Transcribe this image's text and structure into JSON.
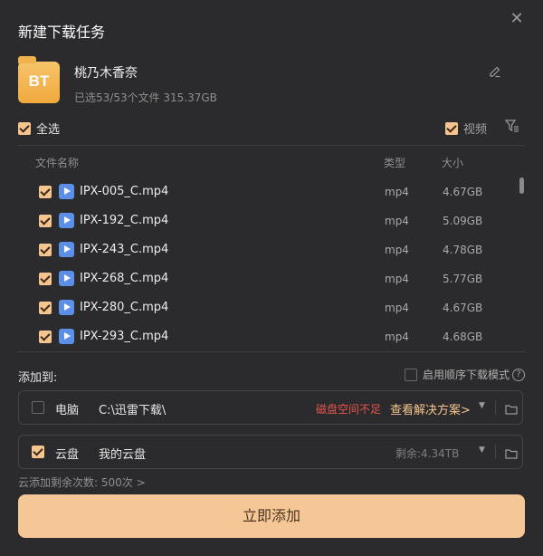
{
  "dialog": {
    "title": "新建下载任务"
  },
  "task": {
    "badge": "BT",
    "name": "桃乃木香奈",
    "info": "已选53/53个文件 315.37GB"
  },
  "filters": {
    "select_all": "全选",
    "video": "视频"
  },
  "columns": {
    "name": "文件名称",
    "type": "类型",
    "size": "大小"
  },
  "files": [
    {
      "name": "IPX-005_C.mp4",
      "type": "mp4",
      "size": "4.67GB"
    },
    {
      "name": "IPX-192_C.mp4",
      "type": "mp4",
      "size": "5.09GB"
    },
    {
      "name": "IPX-243_C.mp4",
      "type": "mp4",
      "size": "4.78GB"
    },
    {
      "name": "IPX-268_C.mp4",
      "type": "mp4",
      "size": "5.77GB"
    },
    {
      "name": "IPX-280_C.mp4",
      "type": "mp4",
      "size": "4.67GB"
    },
    {
      "name": "IPX-293_C.mp4",
      "type": "mp4",
      "size": "4.68GB"
    }
  ],
  "add_to": {
    "label": "添加到:",
    "sequential_label": "启用顺序下载模式",
    "help": "?",
    "local": {
      "label": "电脑",
      "path": "C:\\迅雷下载\\",
      "warning": "磁盘空间不足",
      "solution": "查看解决方案>"
    },
    "cloud": {
      "label": "云盘",
      "path": "我的云盘",
      "remaining": "剩余:4.34TB"
    }
  },
  "quota": "云添加剩余次数: 500次 >",
  "submit": "立即添加",
  "colors": {
    "accent": "#f6c796",
    "warning": "#e5534b",
    "file_icon": "#5b8fe8"
  }
}
